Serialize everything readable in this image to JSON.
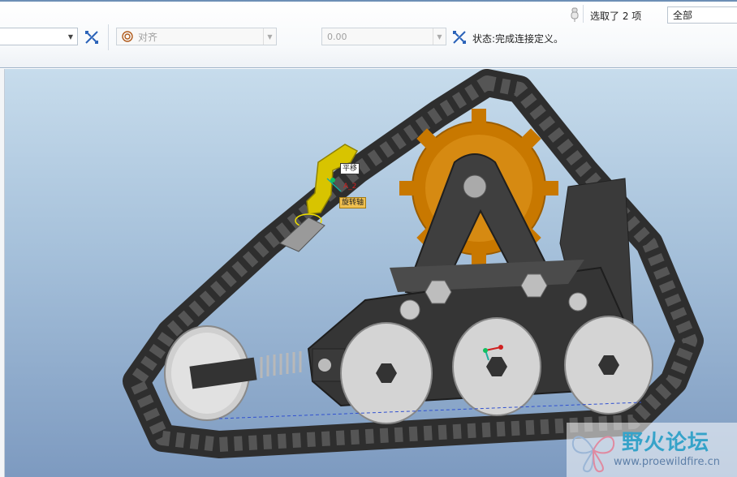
{
  "toolbar": {
    "selection_status": "选取了 2 项",
    "filter_value": "全部",
    "constraint_type": "对齐",
    "offset_value": "0.00",
    "status_text": "状态:完成连接定义。"
  },
  "viewport": {
    "annotations": {
      "label_1": "平移",
      "label_2": "A_2",
      "label_3": "旋转轴"
    }
  },
  "watermark": {
    "title": "野火论坛",
    "url": "www.proewildfire.cn"
  },
  "colors": {
    "accent": "#6d8fb6",
    "track": "#3c3c3c",
    "gear": "#c87800",
    "wheel": "#d4d4d4",
    "selected_part": "#d8c400"
  }
}
